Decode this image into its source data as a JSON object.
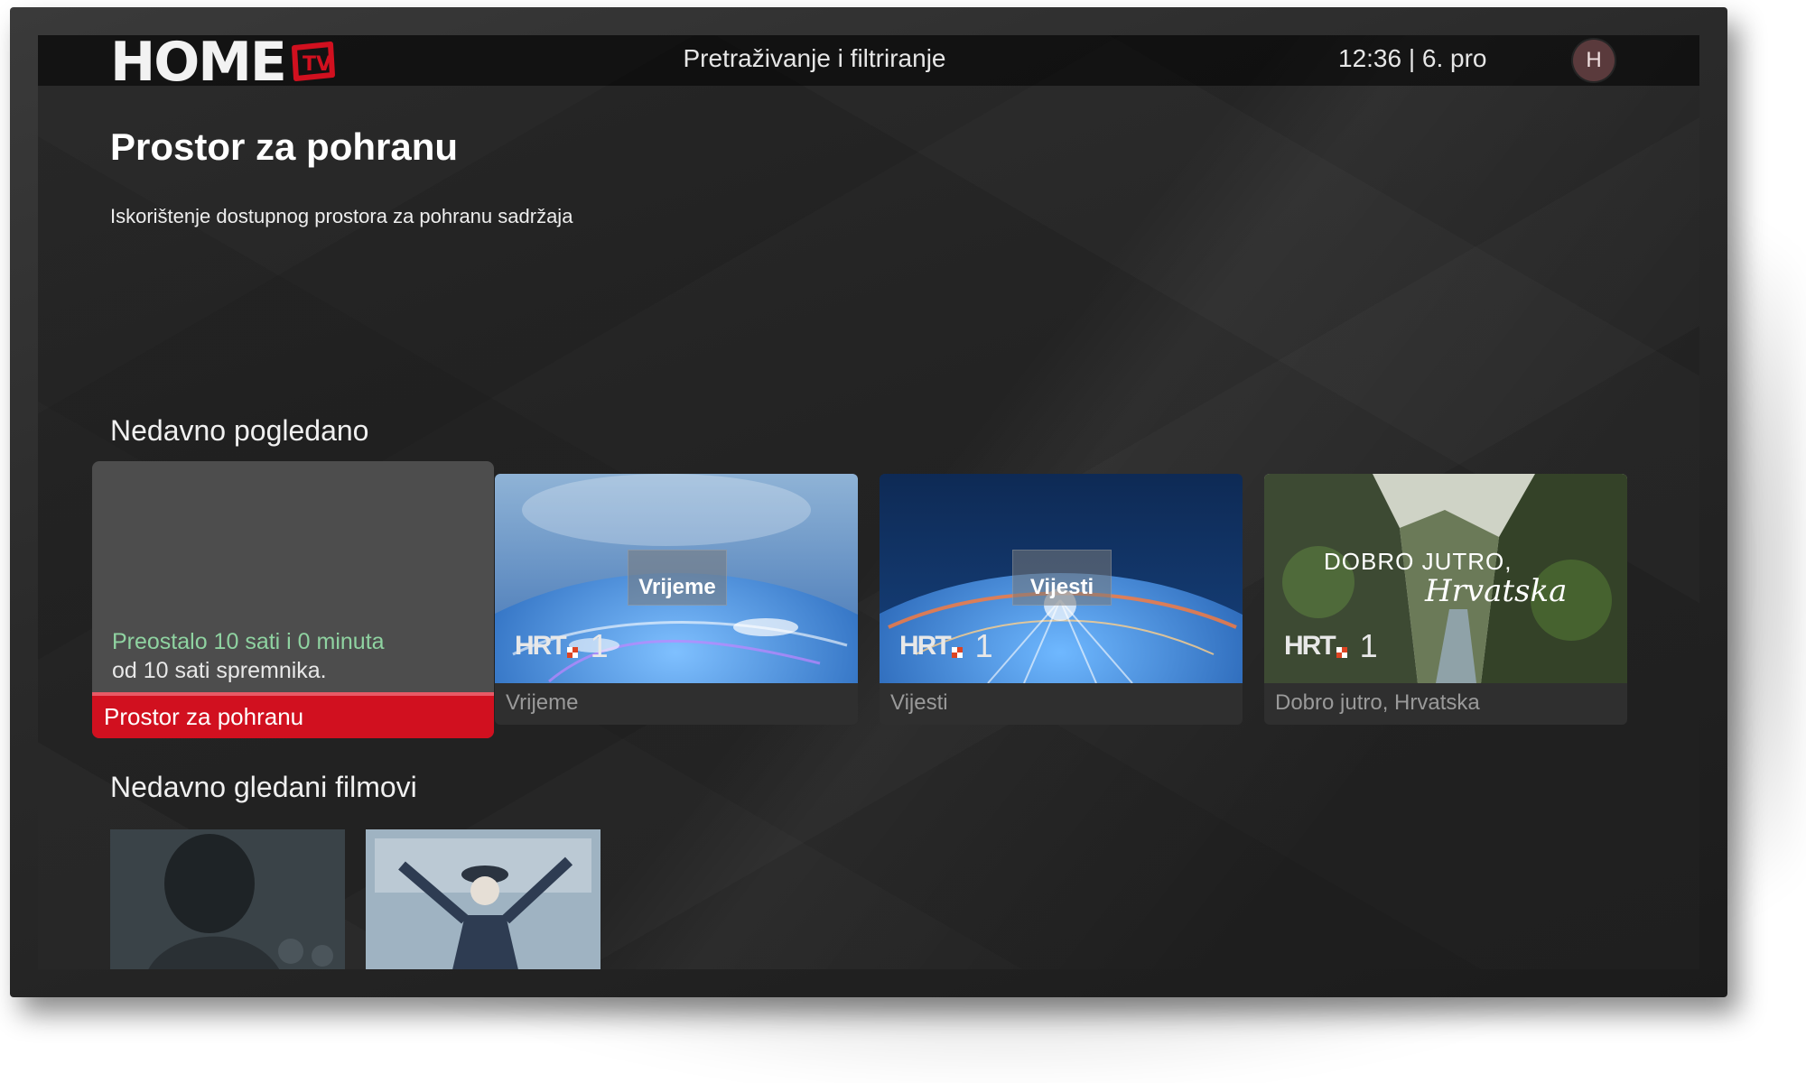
{
  "header": {
    "logo_text": "HOME",
    "logo_badge": "TV",
    "search_label": "Pretraživanje i filtriranje",
    "clock": "12:36 | 6. pro",
    "avatar_initial": "H"
  },
  "page": {
    "title": "Prostor za pohranu",
    "subtitle": "Iskorištenje dostupnog prostora za pohranu sadržaja"
  },
  "sections": {
    "recent": "Nedavno pogledano",
    "recent_movies": "Nedavno gledani filmovi"
  },
  "storage": {
    "remaining": "Preostalo 10 sati i 0 minuta",
    "of_total": "od 10 sati spremnika.",
    "label": "Prostor za pohranu",
    "used_fraction": 0.0
  },
  "recent_items": [
    {
      "title": "Vrijeme",
      "badge": "Vrijeme",
      "channel": "HRT",
      "channel_num": "1"
    },
    {
      "title": "Vijesti",
      "badge": "Vijesti",
      "channel": "HRT",
      "channel_num": "1"
    },
    {
      "title": "Dobro jutro, Hrvatska",
      "overlay_title": "DOBRO JUTRO,",
      "overlay_script": "Hrvatska",
      "channel": "HRT",
      "channel_num": "1"
    }
  ],
  "colors": {
    "accent_red": "#d1101f",
    "remaining_green": "#8fd3a1",
    "screen_bg": "#232323"
  },
  "icons": {
    "logo_tv": "tv-badge-icon"
  }
}
